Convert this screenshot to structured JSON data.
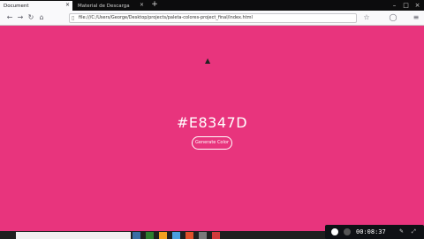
{
  "browser": {
    "tabs": [
      {
        "label": "Document"
      },
      {
        "label": "Material de Descarga"
      }
    ],
    "url": "file:///C:/Users/George/Desktop/projects/paleta-colores-project_final/index.html"
  },
  "main": {
    "color_hex": "#E8347D",
    "generate_label": "Generate Color"
  },
  "recorder": {
    "time": "00:08:37"
  },
  "colors": {
    "background": "#E8347D",
    "text": "#FFFFFF"
  }
}
